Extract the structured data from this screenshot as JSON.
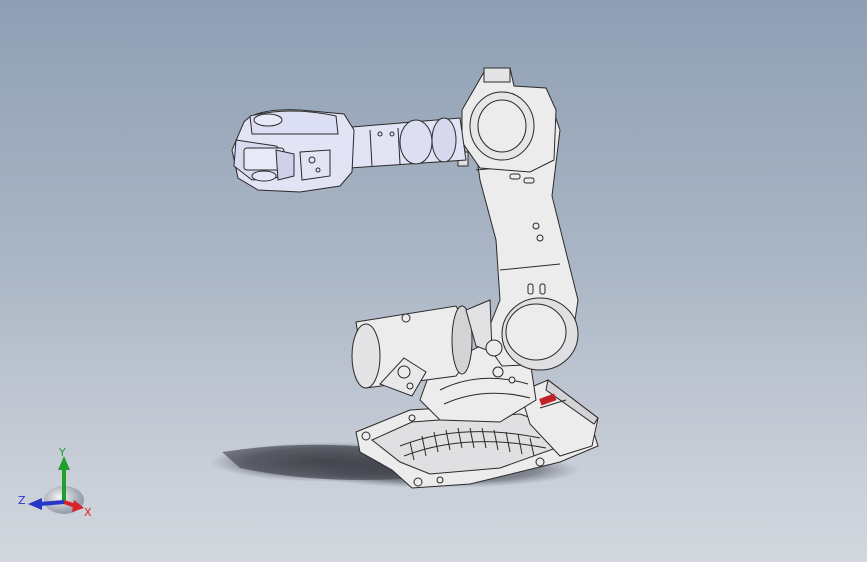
{
  "viewport": {
    "background_top": "#8f9fb4",
    "background_bottom": "#d3d7de"
  },
  "model": {
    "part_fill": "#ececec",
    "part_shade": "#d4d4d6",
    "wrist_fill": "#e2e3f5",
    "edge_color": "#2a2a2a",
    "logo_color": "#c0222a",
    "shadow_color": "#3a3d44"
  },
  "triad": {
    "x_label": "X",
    "y_label": "Y",
    "z_label": "Z",
    "x_color": "#d8232a",
    "y_color": "#1fa02a",
    "z_color": "#2636c8"
  }
}
